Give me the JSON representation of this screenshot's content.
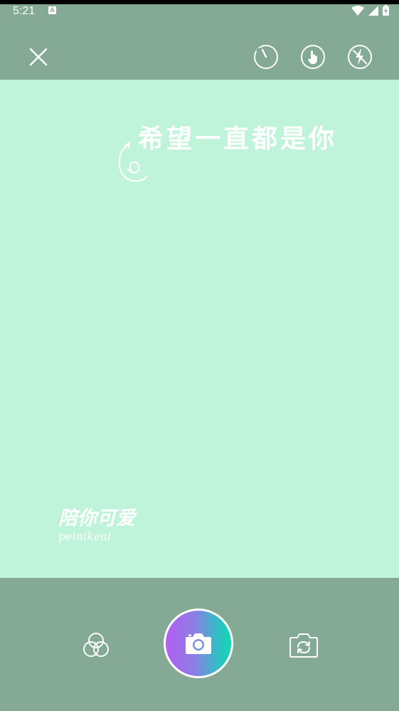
{
  "status_bar": {
    "time": "5:21",
    "notification_badge": "A",
    "icons": [
      "wifi-icon",
      "signal-icon",
      "battery-charging-icon"
    ]
  },
  "top_bar": {
    "icons": [
      "close-icon",
      "timer-icon",
      "touch-shutter-icon",
      "flash-off-icon"
    ]
  },
  "viewfinder": {
    "caption_top": "希望一直都是你",
    "caption_bottom_cn": "陪你可爱",
    "caption_bottom_en": "peinikeai",
    "background": "#bff4da"
  },
  "bottom_bar": {
    "icons": [
      "filter-icon",
      "camera-icon",
      "switch-camera-icon"
    ]
  },
  "colors": {
    "chrome": "#84a995",
    "preview": "#bff4da",
    "shutter_gradient": [
      "#b45ff2",
      "#0ed9b3"
    ]
  }
}
